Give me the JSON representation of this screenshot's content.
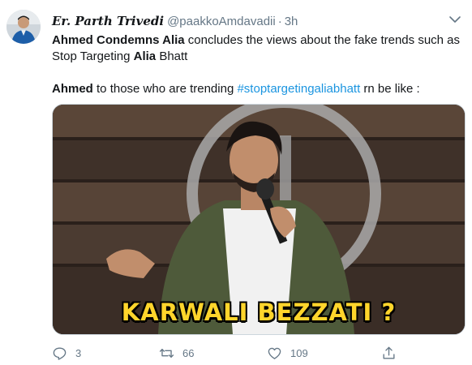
{
  "tweet": {
    "author": {
      "display_name": "Er. Parth Trivedi",
      "handle": "@paakkoAmdavadii",
      "separator": "·",
      "time": "3h"
    },
    "body": {
      "line1_bold_a": "Ahmed Condemns Alia",
      "line1_text_a": " concludes the views about the fake trends such as Stop Targeting ",
      "line1_bold_b": "Alia",
      "line1_text_b": " Bhatt",
      "line2_bold": "Ahmed",
      "line2_text_a": " to those who are trending ",
      "hashtag": "#stoptargetingaliabhatt",
      "line2_text_b": " rn be like :"
    },
    "media": {
      "caption": "KARWALI BEZZATI ?"
    },
    "actions": {
      "reply_count": "3",
      "retweet_count": "66",
      "like_count": "109"
    },
    "icons": [
      "chevron-down-icon",
      "reply-icon",
      "retweet-icon",
      "like-icon",
      "share-icon"
    ],
    "colors": {
      "link": "#1b95e0",
      "muted": "#657786",
      "caption": "#ffd52b"
    }
  }
}
